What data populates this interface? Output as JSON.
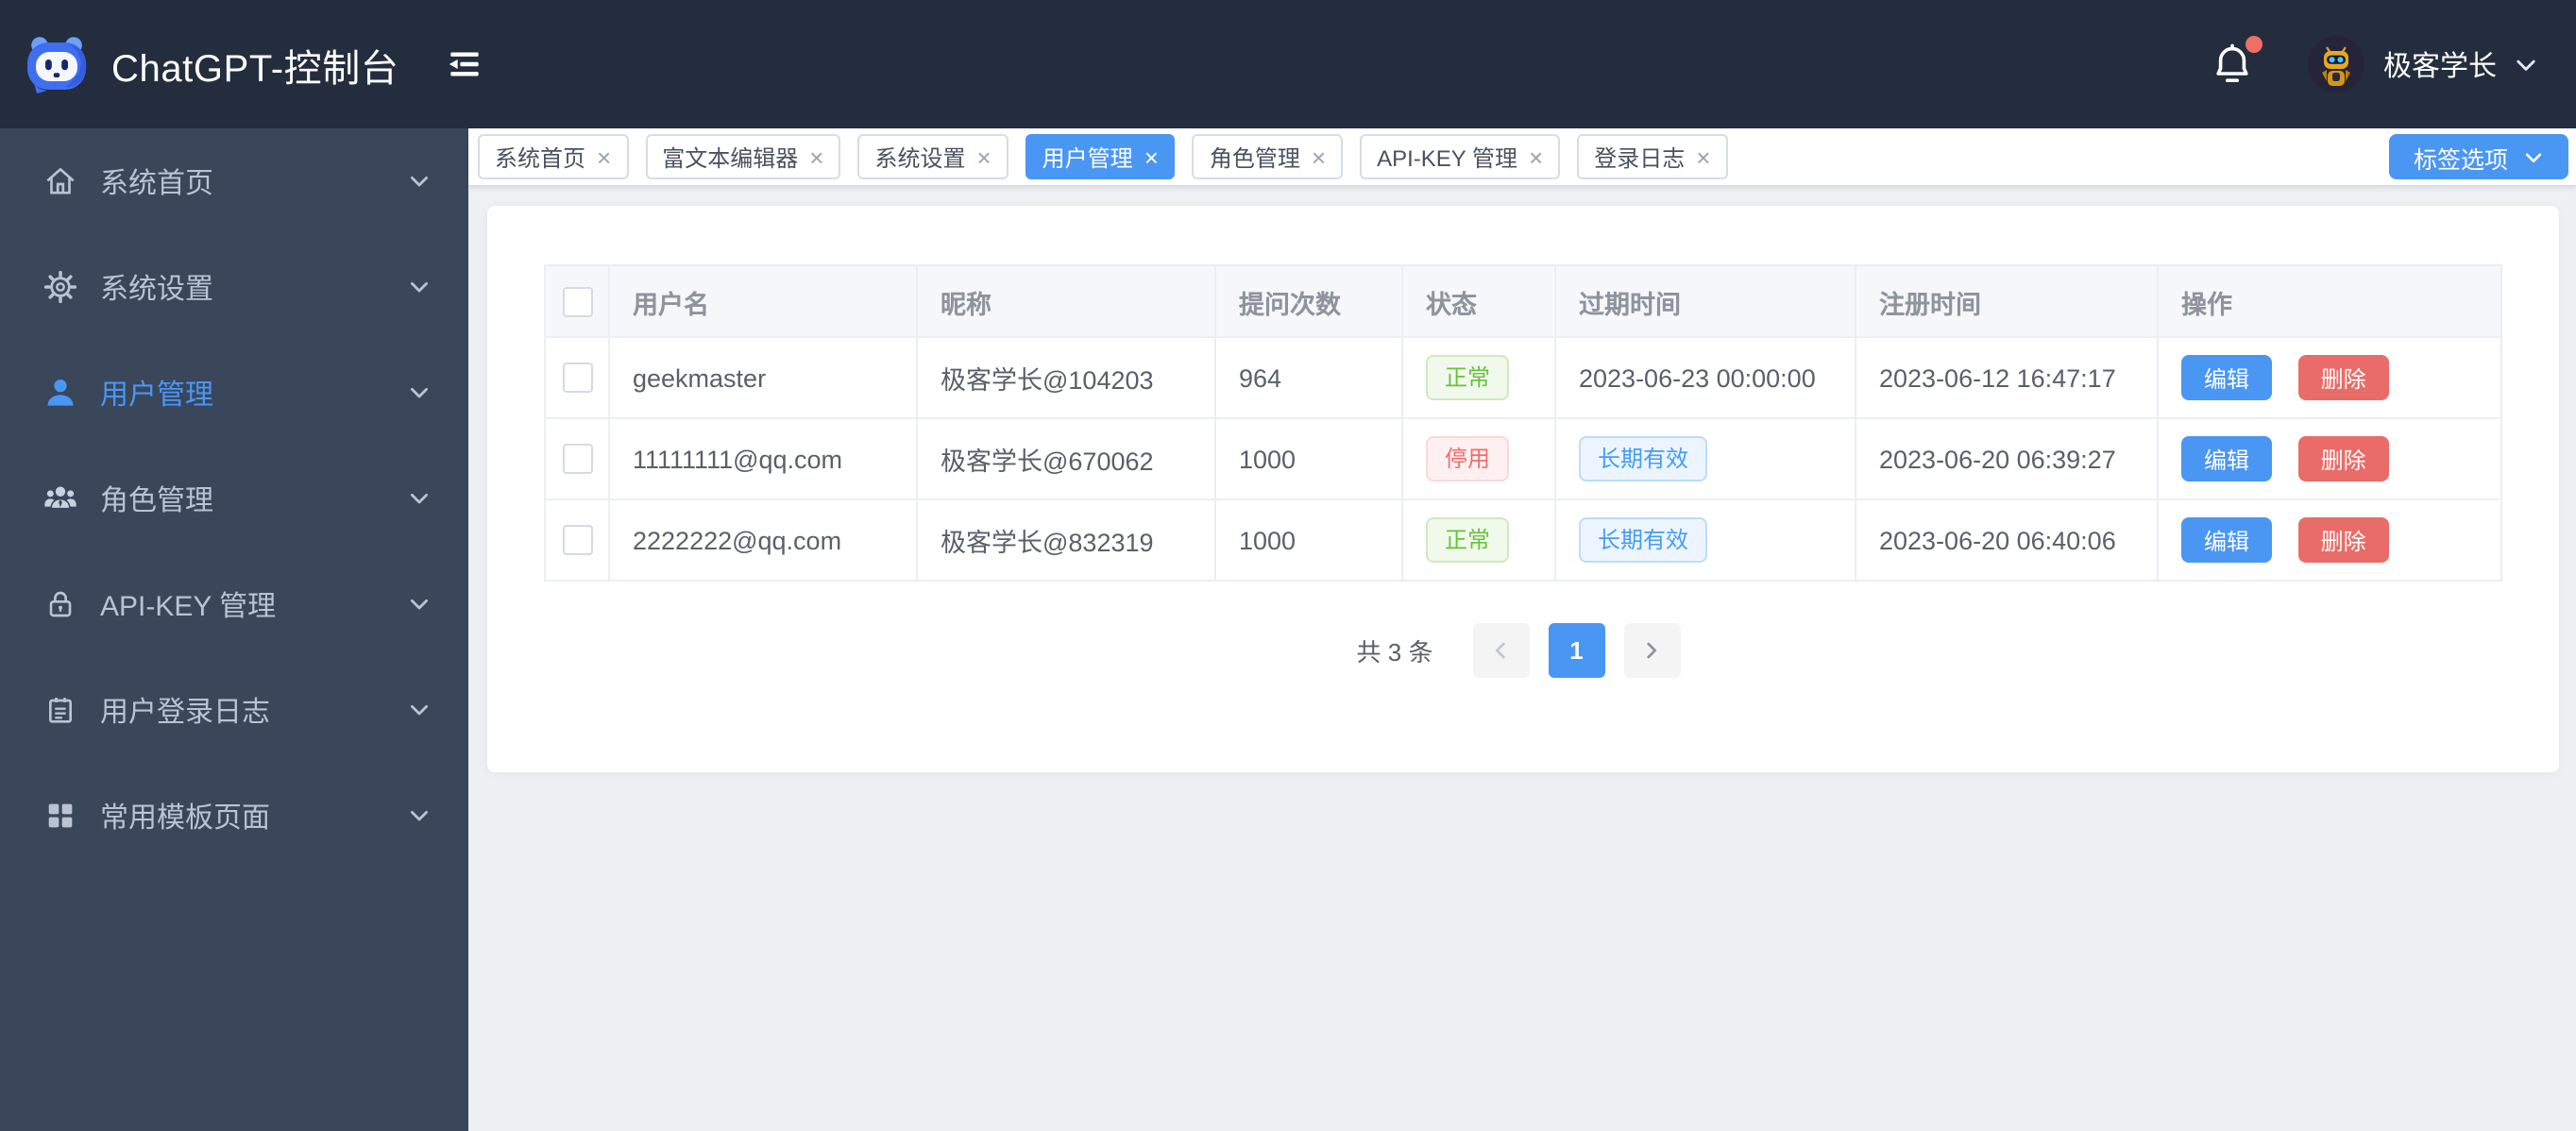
{
  "colors": {
    "accent": "#4a96f3",
    "danger": "#e96c68",
    "header_bg": "#242d3e",
    "sidebar_bg": "#3a465a",
    "content_bg": "#eef0f4",
    "success_text": "#67c23a",
    "success_bg": "#f0f9eb",
    "success_border": "#cfe9bd",
    "danger_text": "#f56c6c",
    "danger_bg": "#fef0f0",
    "danger_border": "#fbd8d8",
    "primary_text": "#459cf7",
    "primary_bg": "#ecf5ff",
    "primary_border": "#bcdcfb"
  },
  "header": {
    "title": "ChatGPT-控制台",
    "user_name": "极客学长"
  },
  "sidebar": {
    "items": [
      {
        "label": "系统首页",
        "icon": "home-icon",
        "active": false,
        "has_children": false
      },
      {
        "label": "系统设置",
        "icon": "gear-icon",
        "active": false,
        "has_children": false
      },
      {
        "label": "用户管理",
        "icon": "user-icon",
        "active": true,
        "has_children": false
      },
      {
        "label": "角色管理",
        "icon": "peoples-icon",
        "active": false,
        "has_children": false
      },
      {
        "label": "API-KEY 管理",
        "icon": "lock-icon",
        "active": false,
        "has_children": false
      },
      {
        "label": "用户登录日志",
        "icon": "log-icon",
        "active": false,
        "has_children": false
      },
      {
        "label": "常用模板页面",
        "icon": "grid-icon",
        "active": false,
        "has_children": true
      }
    ]
  },
  "tabs": {
    "items": [
      {
        "label": "系统首页",
        "active": false
      },
      {
        "label": "富文本编辑器",
        "active": false
      },
      {
        "label": "系统设置",
        "active": false
      },
      {
        "label": "用户管理",
        "active": true
      },
      {
        "label": "角色管理",
        "active": false
      },
      {
        "label": "API-KEY 管理",
        "active": false
      },
      {
        "label": "登录日志",
        "active": false
      }
    ],
    "options_button": "标签选项"
  },
  "table": {
    "headers": [
      "用户名",
      "昵称",
      "提问次数",
      "状态",
      "过期时间",
      "注册时间",
      "操作"
    ],
    "action_labels": {
      "edit": "编辑",
      "delete": "删除"
    },
    "rows": [
      {
        "username": "geekmaster",
        "nickname": "极客学长@104203",
        "count": "964",
        "status": {
          "label": "正常",
          "type": "success"
        },
        "expire": {
          "label": "2023-06-23 00:00:00",
          "tag": false
        },
        "registered": "2023-06-12 16:47:17"
      },
      {
        "username": "11111111@qq.com",
        "nickname": "极客学长@670062",
        "count": "1000",
        "status": {
          "label": "停用",
          "type": "danger"
        },
        "expire": {
          "label": "长期有效",
          "tag": true
        },
        "registered": "2023-06-20 06:39:27"
      },
      {
        "username": "2222222@qq.com",
        "nickname": "极客学长@832319",
        "count": "1000",
        "status": {
          "label": "正常",
          "type": "success"
        },
        "expire": {
          "label": "长期有效",
          "tag": true
        },
        "registered": "2023-06-20 06:40:06"
      }
    ]
  },
  "pagination": {
    "total": "共 3 条",
    "page": "1"
  }
}
